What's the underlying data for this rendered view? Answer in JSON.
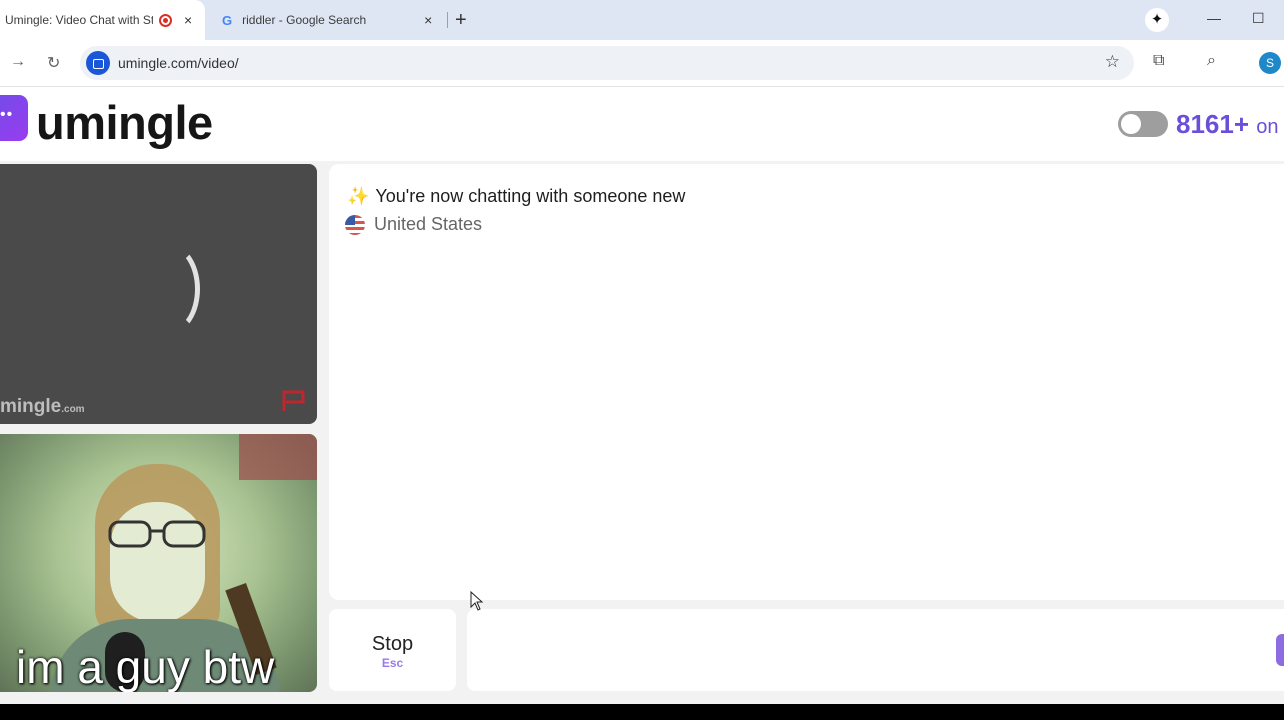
{
  "browser": {
    "tabs": [
      {
        "title": "Umingle: Video Chat with Str",
        "active": true
      },
      {
        "title": "riddler - Google Search",
        "active": false
      }
    ],
    "url": "umingle.com/video/",
    "profile_initial": "S",
    "new_tab_symbol": "+",
    "close_symbol": "×"
  },
  "header": {
    "logo": "umingle",
    "online_count": "8161+",
    "online_word": "on",
    "toggle_state": "off"
  },
  "video": {
    "remote_watermark": "mingle",
    "remote_watermark_suffix": ".com",
    "remote_status": "loading",
    "local_caption": "im a guy btw"
  },
  "chat": {
    "system_message": "You're now chatting with someone new",
    "spark_icon": "✨",
    "country": "United States"
  },
  "controls": {
    "stop_label": "Stop",
    "stop_shortcut": "Esc",
    "message_placeholder": ""
  },
  "colors": {
    "accent": "#6b4fd8",
    "tabstrip": "#dfe6f3"
  }
}
